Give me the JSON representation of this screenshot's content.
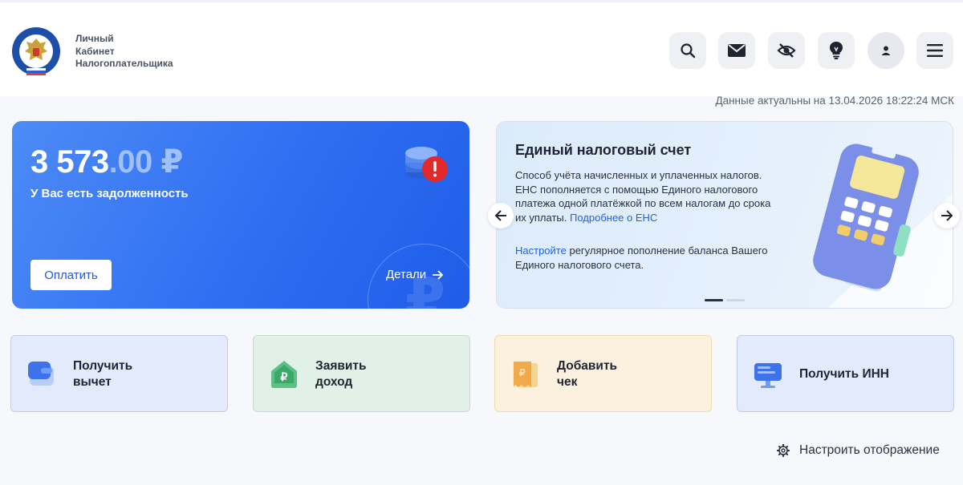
{
  "header": {
    "brand_lines": [
      "Личный",
      "Кабинет",
      "Налогоплательщика"
    ],
    "icons": [
      "search-icon",
      "mail-icon",
      "eye-off-icon",
      "lightbulb-icon",
      "user-icon",
      "menu-icon"
    ]
  },
  "status": {
    "updated_text": "Данные актуальны на 13.04.2026 18:22:24 МСК"
  },
  "debt_card": {
    "amount_int": "3 573",
    "amount_frac": ".00 ₽",
    "label": "У Вас есть задолженность",
    "pay_label": "Оплатить",
    "details_label": "Детали",
    "accent": "#2f6ef2"
  },
  "ens_card": {
    "title": "Единый налоговый счет",
    "text": "Способ учёта начисленных и уплаченных налогов. ЕНС пополняется с помощью Единого налогового платежа одной платёжкой по всем налогам до срока их уплаты.",
    "more_link": "Подробнее о ЕНС",
    "setup_link": "Настройте",
    "setup_text": "регулярное пополнение баланса Вашего Единого налогового счета.",
    "slides_total": 2,
    "slide_active": 1
  },
  "tiles": [
    {
      "line1": "Получить",
      "line2": "вычет",
      "icon": "wallet-icon"
    },
    {
      "line1": "Заявить",
      "line2": "доход",
      "icon": "ruble-house-icon"
    },
    {
      "line1": "Добавить",
      "line2": "чек",
      "icon": "receipt-icon"
    },
    {
      "line1": "Получить ИНН",
      "line2": "",
      "icon": "document-monitor-icon"
    }
  ],
  "footer": {
    "configure_label": "Настроить отображение"
  }
}
